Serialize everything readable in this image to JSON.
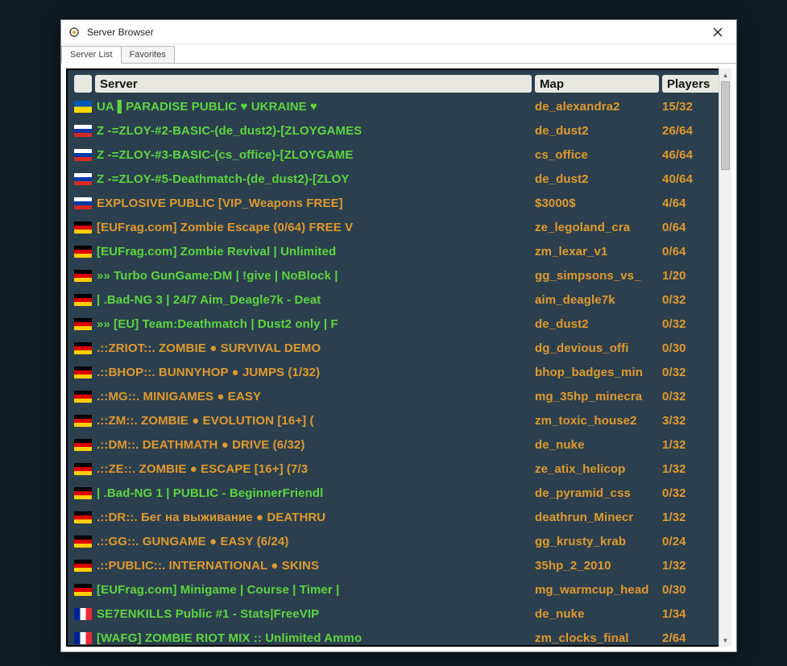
{
  "window": {
    "title": "Server Browser"
  },
  "tabs": [
    {
      "label": "Server List",
      "active": true
    },
    {
      "label": "Favorites",
      "active": false
    }
  ],
  "columns": {
    "server": "Server",
    "map": "Map",
    "players": "Players"
  },
  "servers": [
    {
      "flag": "ua",
      "name": "UA ▌PARADISE PUBLIC ♥ UKRAINE ♥",
      "color": "green",
      "map": "de_alexandra2",
      "players": "15/32"
    },
    {
      "flag": "ru",
      "name": "Z -=ZLOY-#2-BASIC-(de_dust2)-[ZLOYGAMES",
      "color": "green",
      "map": "de_dust2",
      "players": "26/64"
    },
    {
      "flag": "ru",
      "name": "Z -=ZLOY-#3-BASIC-(cs_office)-[ZLOYGAME",
      "color": "green",
      "map": "cs_office",
      "players": "46/64"
    },
    {
      "flag": "ru",
      "name": "Z -=ZLOY-#5-Deathmatch-(de_dust2)-[ZLOY",
      "color": "green",
      "map": "de_dust2",
      "players": "40/64"
    },
    {
      "flag": "ru",
      "name": "EXPLOSIVE PUBLIC [VIP_Weapons FREE]",
      "color": "orange",
      "map": "$3000$",
      "players": "4/64"
    },
    {
      "flag": "de",
      "name": "[EUFrag.com] Zombie Escape (0/64) FREE V",
      "color": "orange",
      "map": "ze_legoland_cra",
      "players": "0/64"
    },
    {
      "flag": "de",
      "name": "[EUFrag.com] Zombie Revival | Unlimited",
      "color": "green",
      "map": "zm_lexar_v1",
      "players": "0/64"
    },
    {
      "flag": "de",
      "name": "»» Turbo GunGame:DM | !give | NoBlock |",
      "color": "green",
      "map": "gg_simpsons_vs_",
      "players": "1/20"
    },
    {
      "flag": "de",
      "name": "| .Bad-NG 3 | 24/7 Aim_Deagle7k - Deat",
      "color": "green",
      "map": "aim_deagle7k",
      "players": "0/32"
    },
    {
      "flag": "de",
      "name": "»» [EU] Team:Deathmatch | Dust2 only | F",
      "color": "green",
      "map": "de_dust2",
      "players": "0/32"
    },
    {
      "flag": "de",
      "name": ".::ZRIOT::. ZOMBIE ● SURVIVAL DEMO",
      "color": "orange",
      "map": "dg_devious_offi",
      "players": "0/30"
    },
    {
      "flag": "de",
      "name": ".::BHOP::. BUNNYHOP ● JUMPS (1/32)",
      "color": "orange",
      "map": "bhop_badges_min",
      "players": "0/32"
    },
    {
      "flag": "de",
      "name": ".::MG::. MINIGAMES ● EASY",
      "color": "orange",
      "map": "mg_35hp_minecra",
      "players": "0/32"
    },
    {
      "flag": "de",
      "name": ".::ZM::. ZOMBIE ● EVOLUTION [16+] (",
      "color": "orange",
      "map": "zm_toxic_house2",
      "players": "3/32"
    },
    {
      "flag": "de",
      "name": ".::DM::. DEATHMATH ● DRIVE (6/32)",
      "color": "orange",
      "map": "de_nuke",
      "players": "1/32"
    },
    {
      "flag": "de",
      "name": ".::ZE::. ZOMBIE ● ESCAPE [16+] (7/3",
      "color": "orange",
      "map": "ze_atix_helicop",
      "players": "1/32"
    },
    {
      "flag": "de",
      "name": "| .Bad-NG 1 | PUBLIC - BeginnerFriendl",
      "color": "green",
      "map": "de_pyramid_css",
      "players": "0/32"
    },
    {
      "flag": "de",
      "name": ".::DR::. Бег на выживание ● DEATHRU",
      "color": "orange",
      "map": "deathrun_Minecr",
      "players": "1/32"
    },
    {
      "flag": "de",
      "name": ".::GG::. GUNGAME ● EASY (6/24)",
      "color": "orange",
      "map": "gg_krusty_krab",
      "players": "0/24"
    },
    {
      "flag": "de",
      "name": ".::PUBLIC::. INTERNATIONAL ● SKINS",
      "color": "orange",
      "map": "35hp_2_2010",
      "players": "1/32"
    },
    {
      "flag": "de",
      "name": "[EUFrag.com] Minigame | Course | Timer |",
      "color": "green",
      "map": "mg_warmcup_head",
      "players": "0/30"
    },
    {
      "flag": "fr",
      "name": "SE7ENKILLS Public #1 - Stats|FreeVIP",
      "color": "green",
      "map": "de_nuke",
      "players": "1/34"
    },
    {
      "flag": "fr",
      "name": "[WAFG] ZOMBIE RIOT MIX :: Unlimited Ammo",
      "color": "green",
      "map": "zm_clocks_final",
      "players": "2/64"
    }
  ]
}
